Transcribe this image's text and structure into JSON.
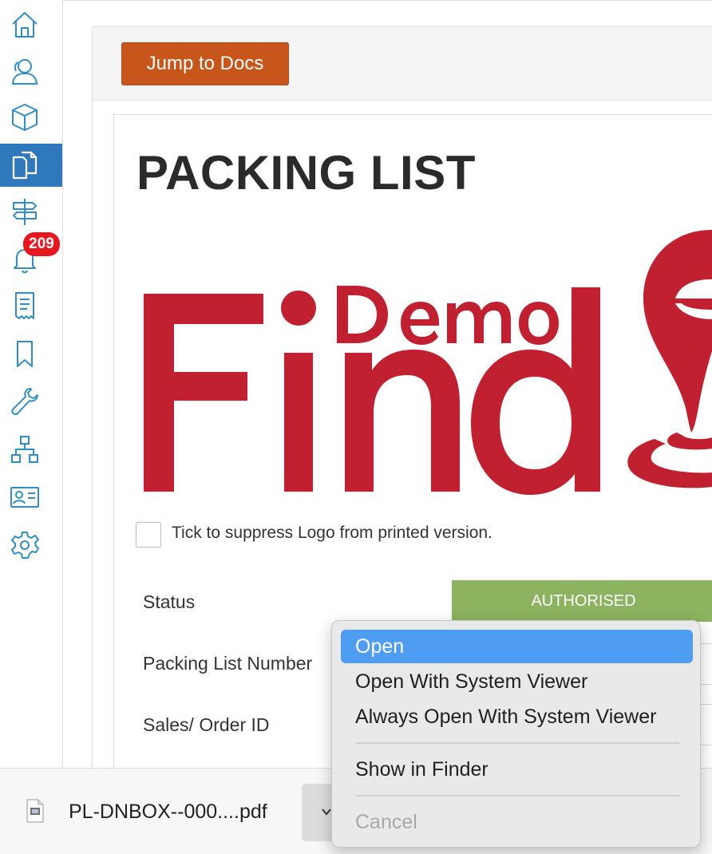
{
  "sidebar": {
    "items": [
      {
        "icon": "home-icon",
        "active": false
      },
      {
        "icon": "users-icon",
        "active": false
      },
      {
        "icon": "box-icon",
        "active": false
      },
      {
        "icon": "documents-icon",
        "active": true
      },
      {
        "icon": "signpost-icon",
        "active": false
      },
      {
        "icon": "bell-icon",
        "active": false
      },
      {
        "icon": "receipt-icon",
        "active": false
      },
      {
        "icon": "bookmark-icon",
        "active": false
      },
      {
        "icon": "wrench-icon",
        "active": false
      },
      {
        "icon": "hierarchy-icon",
        "active": false
      },
      {
        "icon": "id-card-icon",
        "active": false
      },
      {
        "icon": "gear-icon",
        "active": false
      }
    ],
    "notification_count": "209",
    "accent_color": "#2f78bb",
    "icon_color": "#2f8fc4"
  },
  "header": {
    "jump_button_label": "Jump to Docs",
    "jump_button_color": "#c8561b"
  },
  "document": {
    "title": "PACKING LIST",
    "logo_text": "Find",
    "logo_subtext": "Demo",
    "logo_color": "#c0202f",
    "suppress_logo_label": "Tick to suppress Logo from printed version.",
    "fields": {
      "status_label": "Status",
      "status_value": "AUTHORISED",
      "status_color": "#8cb35f",
      "packing_list_number_label": "Packing List Number",
      "sales_order_id_label": "Sales/ Order ID"
    }
  },
  "download_bar": {
    "file_name": "PL-DNBOX--000....pdf"
  },
  "context_menu": {
    "items": [
      {
        "label": "Open",
        "highlighted": true,
        "disabled": false
      },
      {
        "label": "Open With System Viewer",
        "highlighted": false,
        "disabled": false
      },
      {
        "label": "Always Open With System Viewer",
        "highlighted": false,
        "disabled": false
      },
      {
        "label": "Show in Finder",
        "highlighted": false,
        "disabled": false
      },
      {
        "label": "Cancel",
        "highlighted": false,
        "disabled": true
      }
    ],
    "highlight_color": "#4f9cf3"
  }
}
